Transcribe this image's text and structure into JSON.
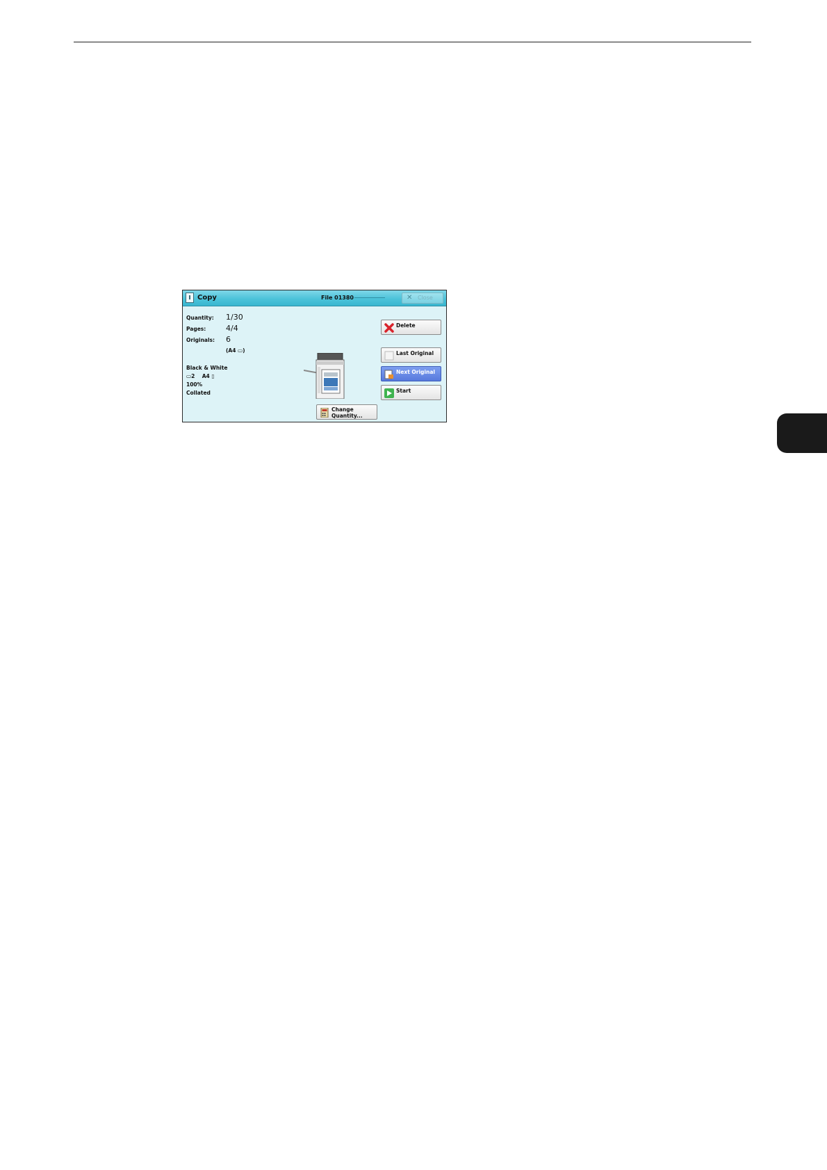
{
  "window": {
    "title": "Copy",
    "file": "File 01380",
    "close_label": "Close"
  },
  "status": {
    "quantity_label": "Quantity:",
    "quantity_value": "1/30",
    "pages_label": "Pages:",
    "pages_value": "4/4",
    "originals_label": "Originals:",
    "originals_value": "6",
    "originals_size": "(A4 ▭)"
  },
  "settings": {
    "color_mode": "Black & White",
    "tray": "▭2    A4 ▯",
    "reduce_enlarge": "100%",
    "output": "Collated"
  },
  "buttons": {
    "delete": "Delete",
    "last_original": "Last Original",
    "next_original": "Next Original",
    "start": "Start",
    "change_quantity_line1": "Change",
    "change_quantity_line2": "Quantity..."
  },
  "colors": {
    "titlebar": "#4cc3da",
    "panel": "#ddf3f7",
    "active_button": "#5779dd"
  }
}
